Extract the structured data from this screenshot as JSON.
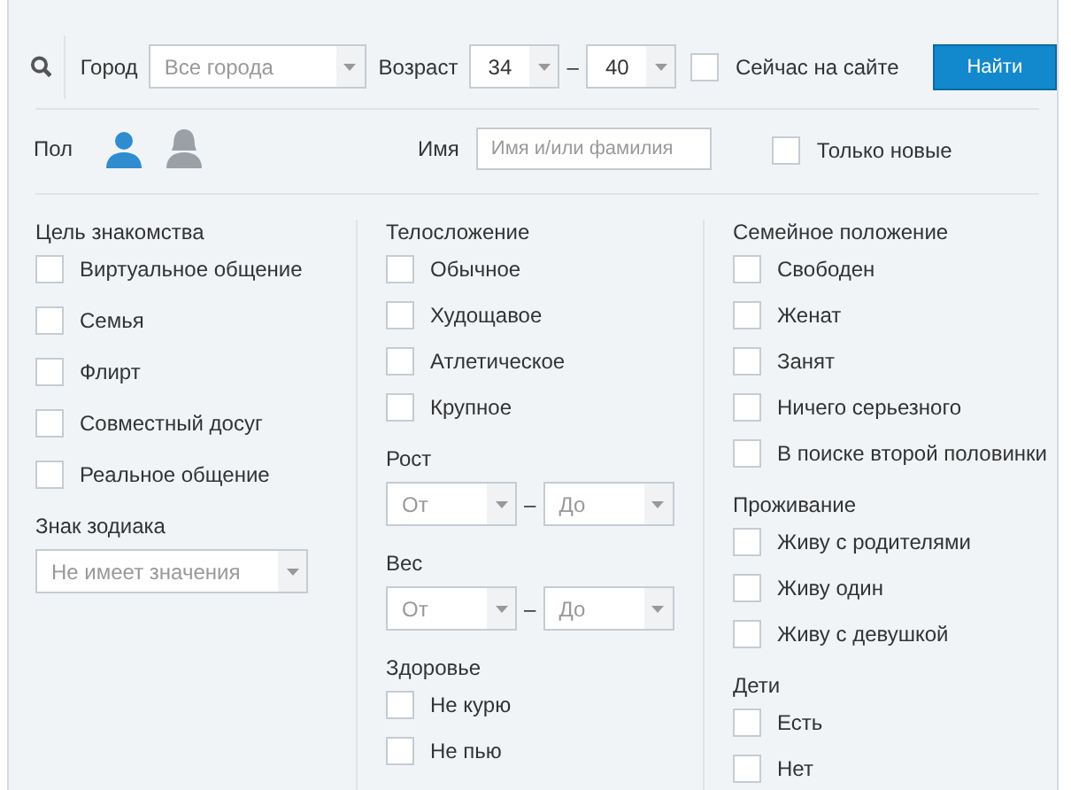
{
  "search_bar": {
    "city_label": "Город",
    "city": {
      "value": "Все города"
    },
    "age_label": "Возраст",
    "age_from": {
      "value": "34"
    },
    "age_separator": "–",
    "age_to": {
      "value": "40"
    },
    "online_now": {
      "label": "Сейчас на сайте",
      "checked": false
    },
    "submit": "Найти"
  },
  "second_row": {
    "gender_label": "Пол",
    "genders": [
      {
        "kind": "male",
        "selected": true
      },
      {
        "kind": "female",
        "selected": false
      }
    ],
    "name_label": "Имя",
    "name_field": {
      "placeholder": "Имя и/или фамилия"
    },
    "only_new": {
      "label": "Только новые",
      "checked": false
    }
  },
  "columns": [
    {
      "sections": [
        {
          "kind": "checkboxes",
          "title": "Цель знакомства",
          "options": [
            {
              "label": "Виртуальное общение",
              "checked": false
            },
            {
              "label": "Семья",
              "checked": false
            },
            {
              "label": "Флирт",
              "checked": false
            },
            {
              "label": "Совместный досуг",
              "checked": false
            },
            {
              "label": "Реальное общение",
              "checked": false
            }
          ]
        },
        {
          "kind": "select",
          "title": "Знак зодиака",
          "value": "Не имеет значения"
        }
      ]
    },
    {
      "sections": [
        {
          "kind": "checkboxes",
          "title": "Телосложение",
          "options": [
            {
              "label": "Обычное",
              "checked": false
            },
            {
              "label": "Худощавое",
              "checked": false
            },
            {
              "label": "Атлетическое",
              "checked": false
            },
            {
              "label": "Крупное",
              "checked": false
            }
          ]
        },
        {
          "kind": "range",
          "title": "Рост",
          "from": "От",
          "separator": "–",
          "to": "До"
        },
        {
          "kind": "range",
          "title": "Вес",
          "from": "От",
          "separator": "–",
          "to": "До"
        },
        {
          "kind": "checkboxes",
          "title": "Здоровье",
          "options": [
            {
              "label": "Не курю",
              "checked": false
            },
            {
              "label": "Не пью",
              "checked": false
            }
          ]
        }
      ]
    },
    {
      "sections": [
        {
          "kind": "checkboxes",
          "title": "Семейное положение",
          "options": [
            {
              "label": "Свободен",
              "checked": false
            },
            {
              "label": "Женат",
              "checked": false
            },
            {
              "label": "Занят",
              "checked": false
            },
            {
              "label": "Ничего серьезного",
              "checked": false
            },
            {
              "label": "В поиске второй половинки",
              "checked": false
            }
          ]
        },
        {
          "kind": "checkboxes",
          "title": "Проживание",
          "options": [
            {
              "label": "Живу с родителями",
              "checked": false
            },
            {
              "label": "Живу один",
              "checked": false
            },
            {
              "label": "Живу с девушкой",
              "checked": false
            }
          ]
        },
        {
          "kind": "checkboxes",
          "title": "Дети",
          "options": [
            {
              "label": "Есть",
              "checked": false
            },
            {
              "label": "Нет",
              "checked": false
            }
          ]
        }
      ]
    }
  ]
}
